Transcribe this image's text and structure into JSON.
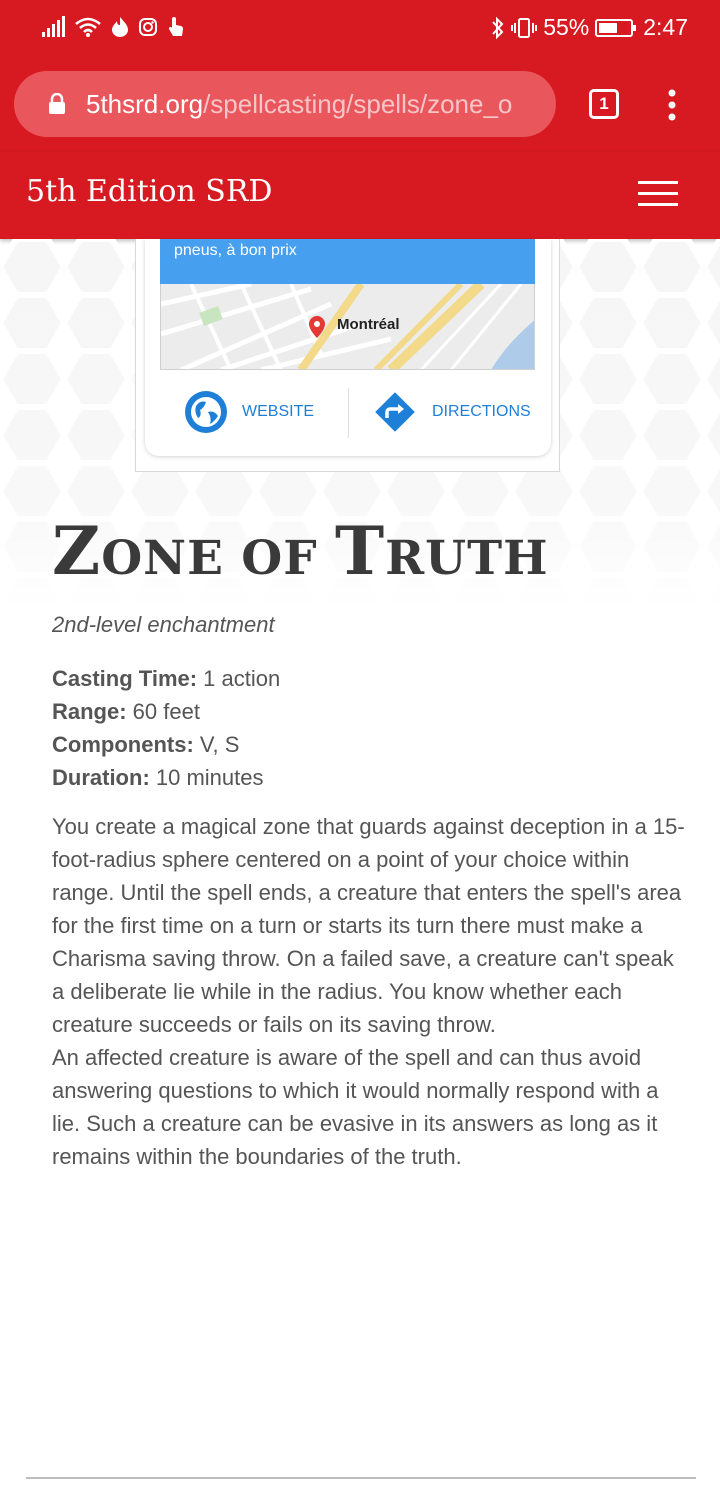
{
  "status_bar": {
    "battery_percent": "55%",
    "time": "2:47"
  },
  "browser": {
    "url_host": "5thsrd.org",
    "url_path": "/spellcasting/spells/zone_o",
    "tab_count": "1"
  },
  "site": {
    "title": "5th Edition SRD"
  },
  "ad": {
    "banner_text": "pneus, à bon prix",
    "map_label": "Montréal",
    "website_label": "WEBSITE",
    "directions_label": "DIRECTIONS"
  },
  "spell": {
    "title_z": "Z",
    "title_one": "ONE ",
    "title_of": "OF ",
    "title_t": "T",
    "title_ruth": "RUTH",
    "subtitle": "2nd-level enchantment",
    "casting_time_label": "Casting Time:",
    "casting_time": " 1 action",
    "range_label": "Range:",
    "range": " 60 feet",
    "components_label": "Components:",
    "components": " V, S",
    "duration_label": "Duration:",
    "duration": " 10 minutes",
    "paragraph_1": "You create a magical zone that guards against deception in a 15-foot-radius sphere centered on a point of your choice within range. Until the spell ends, a creature that enters the spell's area for the first time on a turn or starts its turn there must make a Charisma saving throw. On a failed save, a creature can't speak a deliberate lie while in the radius. You know whether each creature succeeds or fails on its saving throw.",
    "paragraph_2": "An affected creature is aware of the spell and can thus avoid answering questions to which it would normally respond with a lie. Such a creature can be evasive in its answers as long as it remains within the boundaries of the truth."
  },
  "colors": {
    "brand_red": "#d71921",
    "ad_blue": "#46a0ef",
    "link_blue": "#1e7fd8"
  }
}
